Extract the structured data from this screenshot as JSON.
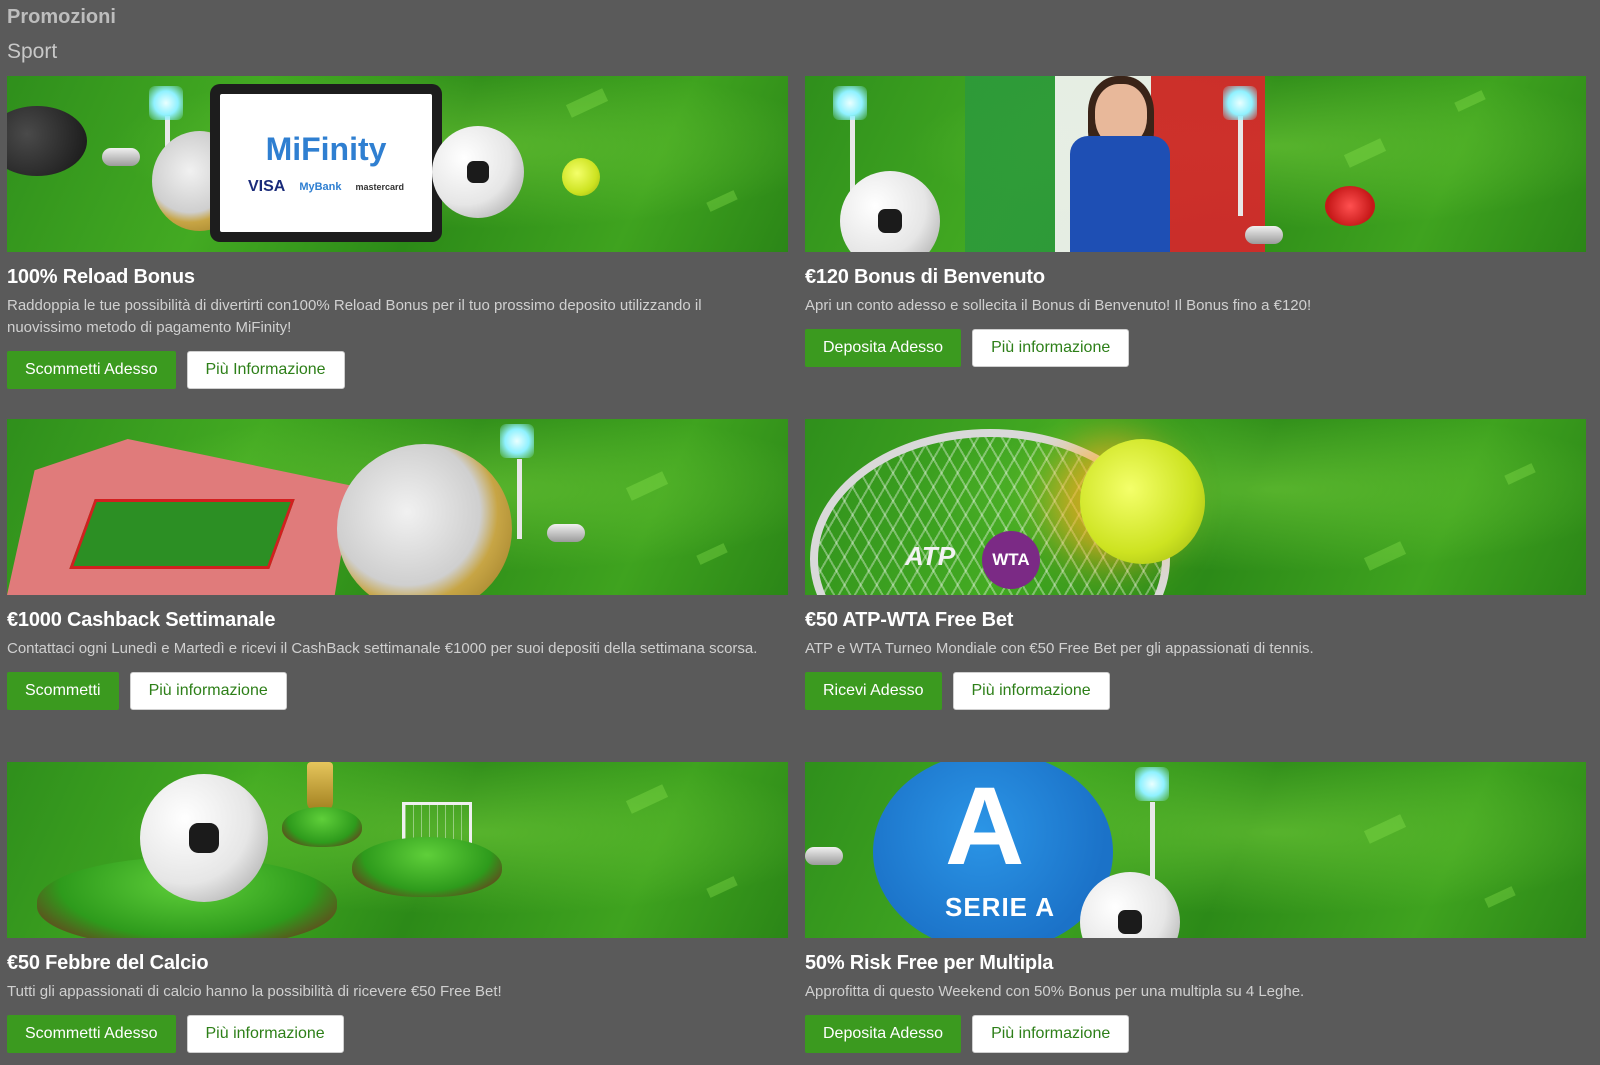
{
  "page": {
    "title": "Promozioni",
    "section": "Sport"
  },
  "promos": [
    {
      "title": "100% Reload Bonus",
      "description": "Raddoppia le tue possibilità di divertirti con100% Reload Bonus per il tuo prossimo deposito utilizzando il nuovissimo metodo di pagamento MiFinity!",
      "primary": "Scommetti Adesso",
      "secondary": "Più Informazione",
      "banner": {
        "logo": "MiFinity",
        "pay1": "VISA",
        "pay2": "MyBank",
        "pay3": "mastercard"
      }
    },
    {
      "title": "€120 Bonus di Benvenuto",
      "description": "Apri un conto adesso e sollecita il Bonus di Benvenuto! Il Bonus fino a €120!",
      "primary": "Deposita Adesso",
      "secondary": "Più informazione"
    },
    {
      "title": "€1000 Cashback Settimanale",
      "description": "Contattaci ogni Lunedì e Martedì e ricevi il CashBack settimanale €1000 per suoi depositi della settimana scorsa.",
      "primary": "Scommetti",
      "secondary": "Più informazione"
    },
    {
      "title": "€50 ATP-WTA Free Bet",
      "description": "ATP e WTA Turneo Mondiale con €50 Free Bet per gli appassionati di tennis.",
      "primary": "Ricevi Adesso",
      "secondary": "Più informazione",
      "banner": {
        "logo1": "ATP",
        "logo2": "WTA"
      }
    },
    {
      "title": "€50 Febbre del Calcio",
      "description": "Tutti gli appassionati di calcio hanno la possibilità di ricevere €50 Free Bet!",
      "primary": "Scommetti Adesso",
      "secondary": "Più informazione"
    },
    {
      "title": "50% Risk Free per Multipla",
      "description": "Approfitta di questo Weekend con 50% Bonus per una multipla su 4 Leghe.",
      "primary": "Deposita Adesso",
      "secondary": "Più informazione",
      "banner": {
        "logo": "SERIE A"
      }
    }
  ],
  "colors": {
    "background": "#5a5a5a",
    "accent": "#3b9a1f",
    "banner_green": "#43aa22"
  }
}
